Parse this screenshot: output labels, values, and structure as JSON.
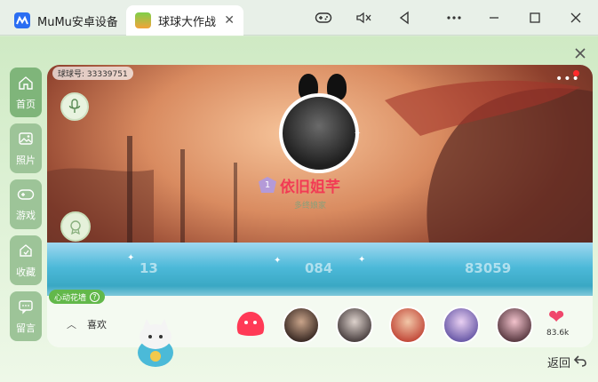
{
  "titlebar": {
    "tabs": [
      {
        "label": "MuMu安卓设备",
        "close": ""
      },
      {
        "label": "球球大作战",
        "close": "✕"
      }
    ],
    "buttons": [
      "gamepad",
      "volume-mute",
      "back",
      "more",
      "minimize",
      "maximize",
      "close"
    ]
  },
  "colors": {
    "accent_green": "#7fb57a",
    "name_red": "#f23b54",
    "heart_pink": "#f0476c",
    "heart_wall_green": "#62b84a"
  },
  "sidenav": [
    {
      "label": "首页",
      "icon": "home-icon"
    },
    {
      "label": "照片",
      "icon": "photo-icon"
    },
    {
      "label": "游戏",
      "icon": "gamepad-icon"
    },
    {
      "label": "收藏",
      "icon": "bookmark-icon"
    },
    {
      "label": "留言",
      "icon": "message-icon"
    }
  ],
  "profile": {
    "uid_label": "球球号: 33339751",
    "user_name": "依旧姐芊",
    "level": "1",
    "sub_label": "多终娘家",
    "stat_left": "13",
    "stat_mid": "084",
    "stat_right": "83059"
  },
  "heart_wall": {
    "label": "心动花墙",
    "help": "?"
  },
  "likes": {
    "label": "喜欢",
    "count": "83.6k"
  },
  "back_label": "返回"
}
